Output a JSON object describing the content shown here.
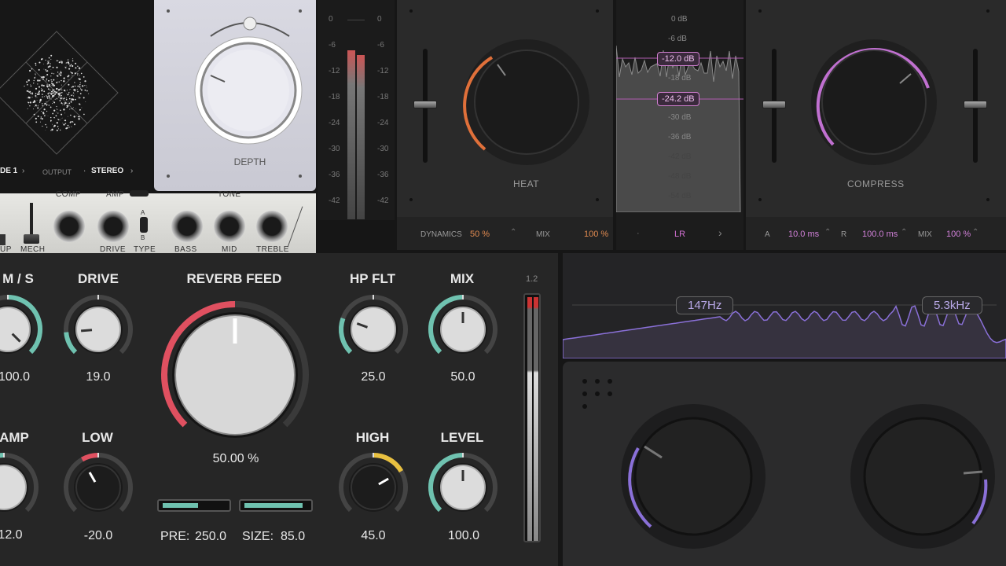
{
  "scope": {
    "mode": "DE 1",
    "output_label": "OUTPUT",
    "output_value": "STEREO"
  },
  "depth": {
    "label": "DEPTH"
  },
  "amp": {
    "labels": [
      "COMP",
      "AMP",
      "TONE",
      "UP",
      "MECH",
      "DRIVE",
      "TYPE",
      "BASS",
      "MID",
      "TREBLE"
    ],
    "switch_a": "A",
    "switch_b": "B"
  },
  "meter": {
    "scale": [
      "0",
      "-6",
      "-12",
      "-18",
      "-24",
      "-30",
      "-36",
      "-42"
    ]
  },
  "heat": {
    "label": "HEAT",
    "dynamics_label": "DYNAMICS",
    "dynamics_value": "50 %",
    "mix_label": "MIX",
    "mix_value": "100 %",
    "accent": "#e0703a"
  },
  "spectrum": {
    "scale": [
      "0 dB",
      "-6 dB",
      "-12.0 dB",
      "-18 dB",
      "-24.2 dB",
      "-30 dB",
      "-36 dB",
      "-42 dB",
      "-48 dB",
      "-54 dB"
    ],
    "channel": "LR"
  },
  "compress": {
    "label": "COMPRESS",
    "attack_label": "A",
    "attack_value": "10.0 ms",
    "release_label": "R",
    "release_value": "100.0 ms",
    "mix_label": "MIX",
    "mix_value": "100 %",
    "accent": "#c070d0"
  },
  "main": {
    "knobs": [
      {
        "label": "M / S",
        "value": "100.0"
      },
      {
        "label": "DRIVE",
        "value": "19.0"
      },
      {
        "label": "HP FLT",
        "value": "25.0"
      },
      {
        "label": "MIX",
        "value": "50.0"
      },
      {
        "label": "AMP",
        "value": "12.0"
      },
      {
        "label": "LOW",
        "value": "-20.0"
      },
      {
        "label": "HIGH",
        "value": "45.0"
      },
      {
        "label": "LEVEL",
        "value": "100.0"
      }
    ],
    "reverb": {
      "label": "REVERB FEED",
      "value": "50.00 %",
      "pre_label": "PRE:",
      "pre_value": "250.0",
      "size_label": "SIZE:",
      "size_value": "85.0"
    },
    "meter_top": "1.2"
  },
  "eq": {
    "low_freq": "147Hz",
    "high_freq": "5.3kHz"
  },
  "colors": {
    "teal": "#6fc2b0",
    "red": "#e05060",
    "yellow": "#e8c040",
    "purple": "#8a70d8"
  }
}
